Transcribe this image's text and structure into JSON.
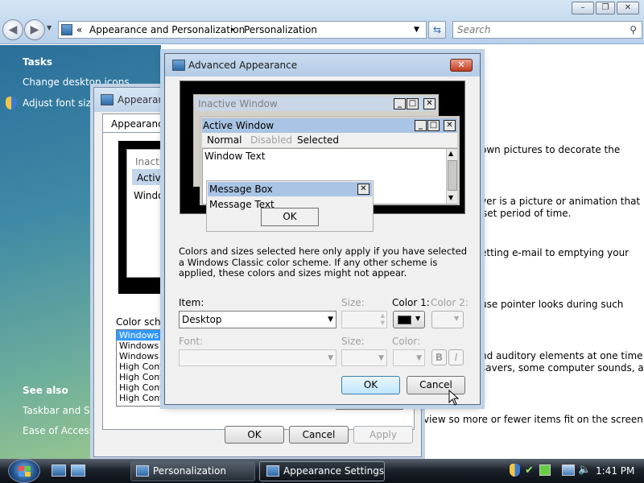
{
  "window_controls": [
    "–",
    "❐",
    "✕"
  ],
  "address": {
    "prefix": "«",
    "crumb1": "Appearance and Personalization",
    "sep": "▸",
    "crumb2": "Personalization"
  },
  "search": {
    "placeholder": "Search"
  },
  "left_pane": {
    "tasks_heading": "Tasks",
    "task_items": [
      "Change desktop icons",
      "Adjust font size ("
    ],
    "see_also_heading": "See also",
    "see_also_items": [
      "Taskbar and Star",
      "Ease of Access"
    ]
  },
  "right_fragments": [
    "own pictures to decorate the",
    "ver is a picture or animation that",
    "set period of time.",
    "etting e-mail to emptying your",
    "use pointer looks during such",
    "nd auditory elements at one time",
    "savers, some computer sounds, and",
    "view so more or fewer items fit on the screen."
  ],
  "bg_dialog": {
    "title": "Appearan",
    "tab": "Appearance",
    "preview_inactive": "Inactiv",
    "preview_active": "Activ",
    "preview_text": "Windo",
    "scheme_label": "Color scheme",
    "schemes": [
      "Windows Vi",
      "Windows St",
      "Windows Cl",
      "High Contra",
      "High Contra",
      "High Contra",
      "High Contra"
    ],
    "ok": "OK",
    "cancel": "Cancel",
    "apply": "Apply"
  },
  "adv": {
    "title": "Advanced Appearance",
    "close": "✕",
    "preview": {
      "inactive_window": "Inactive Window",
      "active_window": "Active Window",
      "menu_normal": "Normal",
      "menu_disabled": "Disabled",
      "menu_selected": "Selected",
      "window_text": "Window Text",
      "message_box": "Message Box",
      "message_text": "Message Text",
      "ok": "OK"
    },
    "info": "Colors and sizes selected here only apply if you have selected a Windows Classic color scheme. If any other scheme is applied, these colors and sizes might not appear.",
    "item_label": "Item:",
    "item_value": "Desktop",
    "size_label": "Size:",
    "color1_label": "Color 1:",
    "color2_label": "Color 2:",
    "color1_value": "#000000",
    "font_label": "Font:",
    "font_size_label": "Size:",
    "font_color_label": "Color:",
    "bold": "B",
    "italic": "I",
    "ok": "OK",
    "cancel": "Cancel"
  },
  "taskbar": {
    "start": "Start",
    "items": [
      "Personalization",
      "Appearance Settings"
    ],
    "clock": "1:41 PM"
  },
  "colors": {
    "accent": "#2b6f9b",
    "desktop_preview": "#000000",
    "active_title": "#a9c4e4",
    "inactive_title": "#c8d6e6"
  }
}
